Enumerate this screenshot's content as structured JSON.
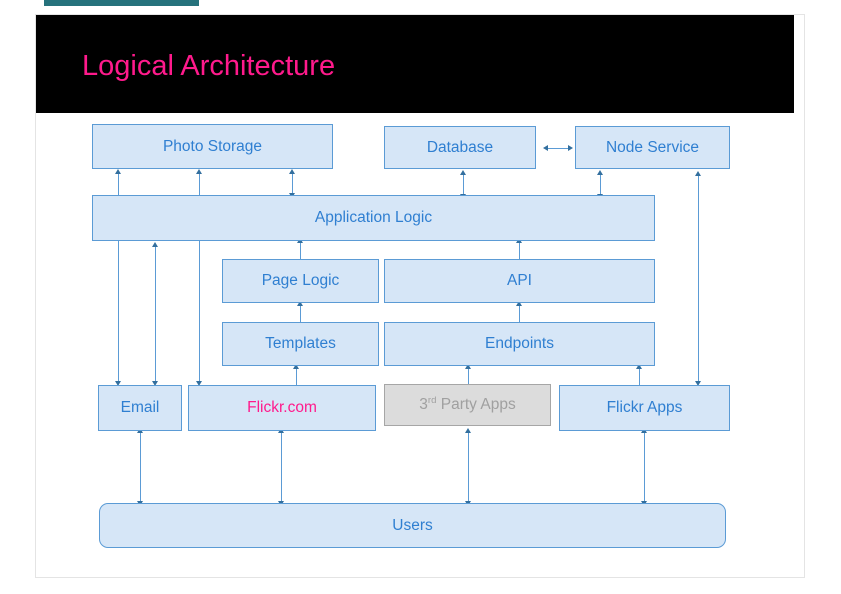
{
  "slide": {
    "title": "Logical Architecture",
    "title_color": "#ff1a8c",
    "title_band_color": "#000000",
    "frame_border_color": "#e4e4e4",
    "tab_color": "#26727c"
  },
  "theme": {
    "box_fill": "#d6e6f7",
    "box_border": "#5b9bd5",
    "box_text": "#2f7fd1",
    "gray_fill": "#dcdcdc",
    "gray_border": "#a6a6a6",
    "gray_text": "#a0a0a0",
    "accent_pink": "#ff1a8c",
    "arrow_color": "#5b9bd5"
  },
  "nodes": {
    "photo_storage": "Photo Storage",
    "database": "Database",
    "node_service": "Node Service",
    "application_logic": "Application Logic",
    "page_logic": "Page Logic",
    "api": "API",
    "templates": "Templates",
    "endpoints": "Endpoints",
    "email": "Email",
    "flickr_com": "Flickr.com",
    "third_party_apps_num": "3",
    "third_party_apps_sup": "rd",
    "third_party_apps_rest": " Party Apps",
    "flickr_apps": "Flickr Apps",
    "users": "Users"
  },
  "connections": [
    {
      "name": "database-to-node-service",
      "type": "bidirectional",
      "orientation": "horizontal"
    },
    {
      "name": "photo-storage-to-application-logic",
      "type": "bidirectional",
      "orientation": "vertical"
    },
    {
      "name": "database-to-application-logic",
      "type": "bidirectional",
      "orientation": "vertical"
    },
    {
      "name": "node-service-to-application-logic",
      "type": "bidirectional",
      "orientation": "vertical"
    },
    {
      "name": "application-logic-to-page-logic",
      "type": "bidirectional",
      "orientation": "vertical"
    },
    {
      "name": "application-logic-to-api",
      "type": "bidirectional",
      "orientation": "vertical"
    },
    {
      "name": "page-logic-to-templates",
      "type": "bidirectional",
      "orientation": "vertical"
    },
    {
      "name": "api-to-endpoints",
      "type": "bidirectional",
      "orientation": "vertical"
    },
    {
      "name": "templates-to-flickr-com",
      "type": "bidirectional",
      "orientation": "vertical"
    },
    {
      "name": "endpoints-to-third-party-apps",
      "type": "bidirectional",
      "orientation": "vertical"
    },
    {
      "name": "endpoints-to-flickr-apps",
      "type": "bidirectional",
      "orientation": "vertical"
    },
    {
      "name": "photo-storage-to-email",
      "type": "bidirectional",
      "orientation": "vertical"
    },
    {
      "name": "photo-storage-to-flickr-com",
      "type": "bidirectional",
      "orientation": "vertical"
    },
    {
      "name": "application-logic-to-flickr-com",
      "type": "bidirectional",
      "orientation": "vertical"
    },
    {
      "name": "node-service-to-flickr-apps",
      "type": "bidirectional",
      "orientation": "vertical"
    },
    {
      "name": "email-to-users",
      "type": "bidirectional",
      "orientation": "vertical"
    },
    {
      "name": "flickr-com-to-users",
      "type": "bidirectional",
      "orientation": "vertical"
    },
    {
      "name": "third-party-apps-to-users",
      "type": "bidirectional",
      "orientation": "vertical"
    },
    {
      "name": "flickr-apps-to-users",
      "type": "bidirectional",
      "orientation": "vertical"
    }
  ]
}
